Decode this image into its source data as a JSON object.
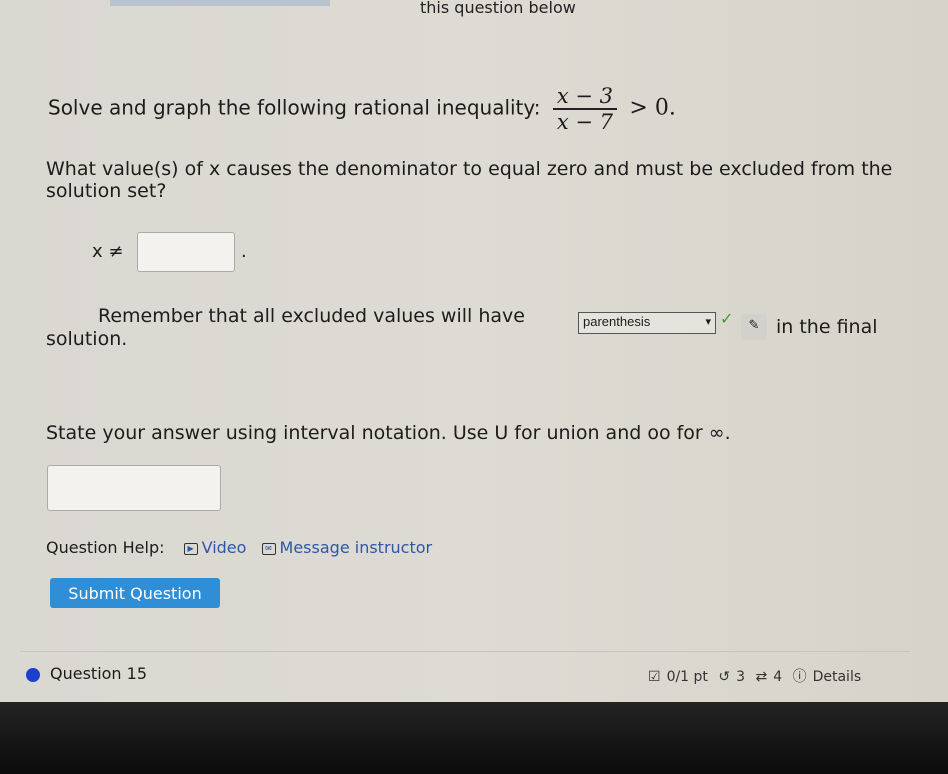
{
  "header": {
    "note": "this question below"
  },
  "question": {
    "prompt": "Solve and graph the following rational inequality:",
    "numerator": "x − 3",
    "denominator": "x − 7",
    "relation": "> 0."
  },
  "part1": {
    "text": "What value(s) of x causes the denominator to equal zero and must be excluded from the solution set?",
    "lhs": "x ≠",
    "answer_value": "",
    "period": "."
  },
  "part2": {
    "text_before": "Remember that all excluded values will have",
    "select_value": "parenthesis",
    "text_after": "in the final",
    "text_line2": "solution.",
    "status": "correct"
  },
  "part3": {
    "text": "State your answer using interval notation. Use U for union and oo for ∞.",
    "answer_value": ""
  },
  "help": {
    "label": "Question Help:",
    "video": "Video",
    "message": "Message instructor"
  },
  "submit_label": "Submit Question",
  "next": {
    "title": "Question 15",
    "points": "0/1 pt",
    "retries": "3",
    "attempts": "4",
    "details": "Details"
  },
  "colors": {
    "submit": "#2f8ed6",
    "link": "#2f56a8",
    "dot": "#1d3fd1",
    "check": "#3b9a3b"
  }
}
